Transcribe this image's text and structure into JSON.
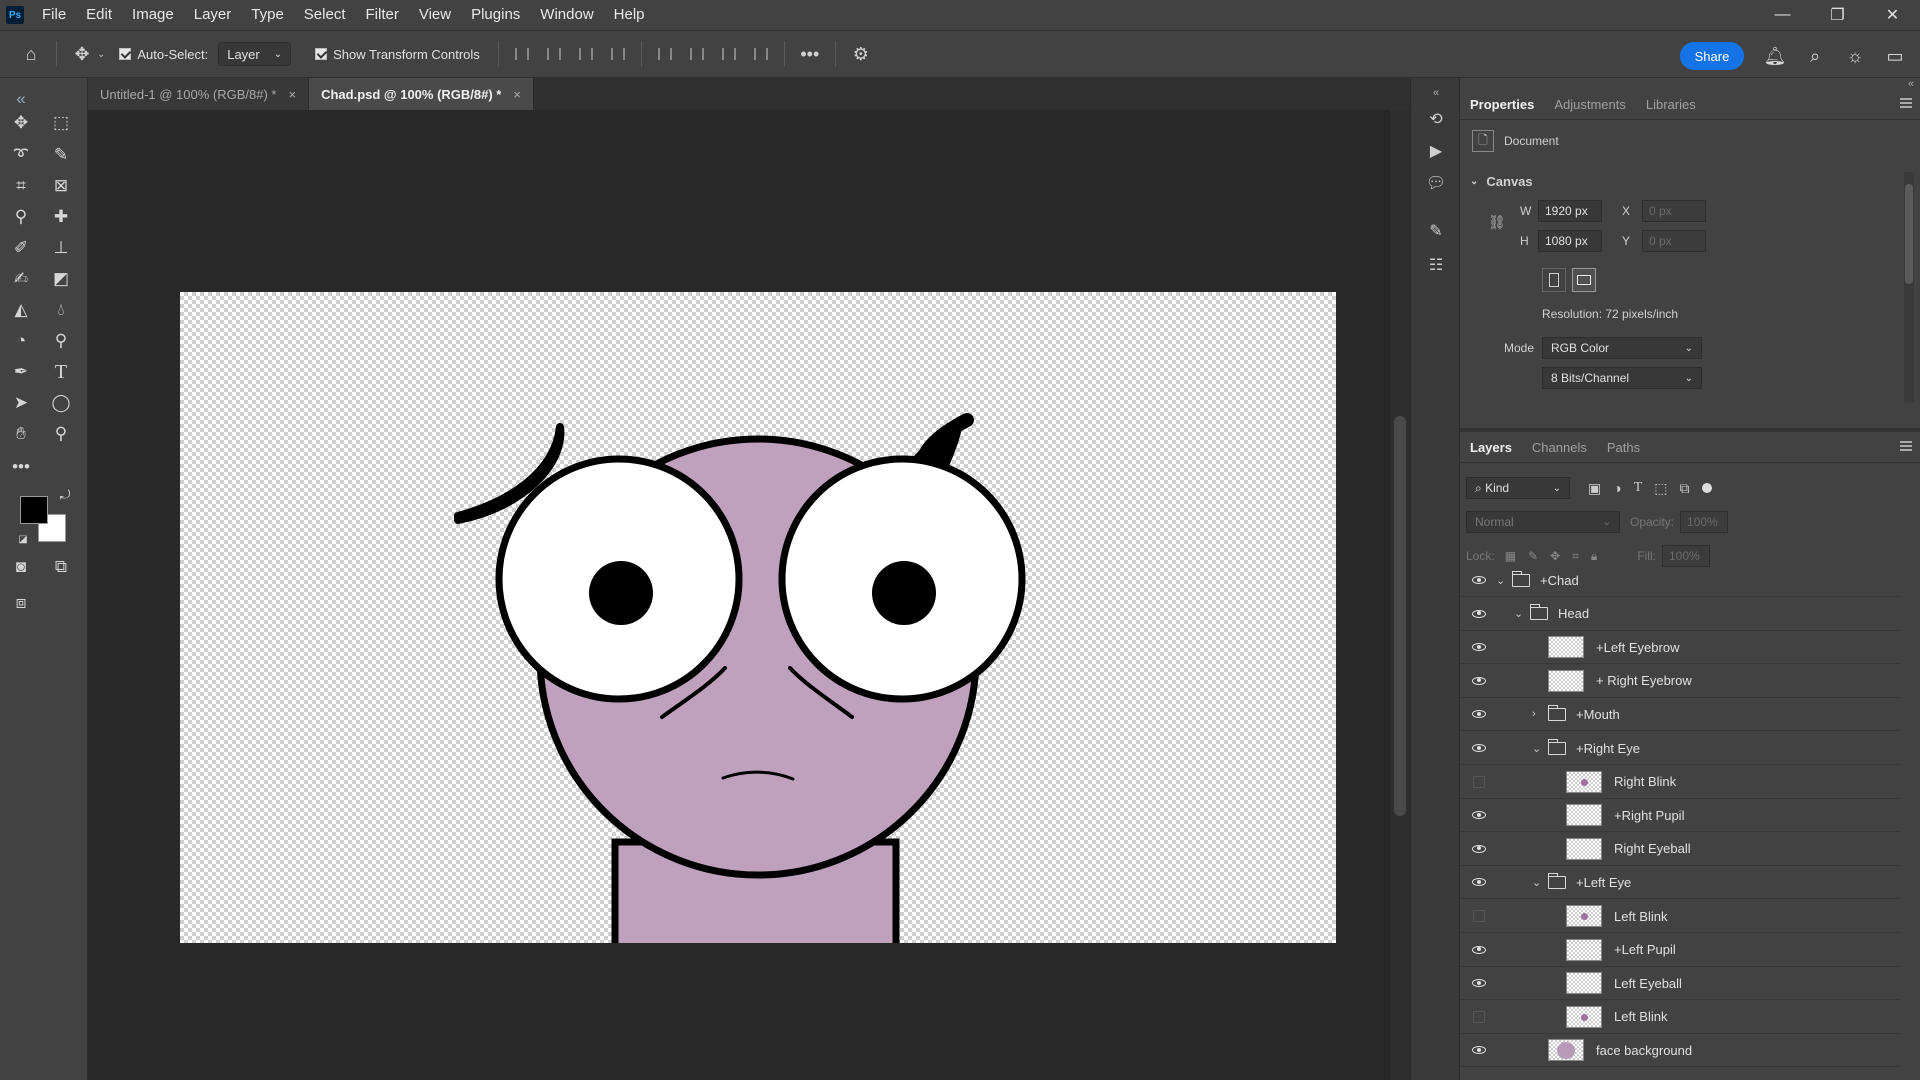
{
  "app": {
    "logo": "Ps"
  },
  "menu": [
    "File",
    "Edit",
    "Image",
    "Layer",
    "Type",
    "Select",
    "Filter",
    "View",
    "Plugins",
    "Window",
    "Help"
  ],
  "window_controls": {
    "minimize": "—",
    "restore": "❐",
    "close": "✕"
  },
  "options": {
    "auto_select_label": "Auto-Select:",
    "auto_select_checked": true,
    "auto_select_target": "Layer",
    "show_transform_label": "Show Transform Controls",
    "show_transform_checked": true,
    "more": "•••",
    "share_label": "Share"
  },
  "tabs": [
    {
      "label": "Untitled-1 @ 100% (RGB/8#) *",
      "active": false
    },
    {
      "label": "Chad.psd @ 100% (RGB/8#) *",
      "active": true
    }
  ],
  "tab_close": "×",
  "properties_panel": {
    "tabs": [
      "Properties",
      "Adjustments",
      "Libraries"
    ],
    "active_tab": "Properties",
    "document_label": "Document",
    "canvas_section": "Canvas",
    "w_label": "W",
    "w_value": "1920 px",
    "h_label": "H",
    "h_value": "1080 px",
    "x_label": "X",
    "x_placeholder": "0 px",
    "y_label": "Y",
    "y_placeholder": "0 px",
    "resolution": "Resolution: 72 pixels/inch",
    "mode_label": "Mode",
    "mode_value": "RGB Color",
    "depth_value": "8 Bits/Channel"
  },
  "layers_panel": {
    "tabs": [
      "Layers",
      "Channels",
      "Paths"
    ],
    "active_tab": "Layers",
    "filter_kind": "Kind",
    "blend_mode": "Normal",
    "opacity_label": "Opacity:",
    "opacity_value": "100%",
    "lock_label": "Lock:",
    "fill_label": "Fill:",
    "fill_value": "100%",
    "layers": [
      {
        "name": "+Chad",
        "type": "group",
        "depth": 0,
        "expanded": true,
        "visible": true
      },
      {
        "name": "Head",
        "type": "group",
        "depth": 1,
        "expanded": true,
        "visible": true
      },
      {
        "name": "+Left Eyebrow",
        "type": "layer",
        "depth": 2,
        "visible": true
      },
      {
        "name": "+ Right Eyebrow",
        "type": "layer",
        "depth": 2,
        "visible": true
      },
      {
        "name": "+Mouth",
        "type": "group",
        "depth": 2,
        "expanded": false,
        "visible": true
      },
      {
        "name": "+Right Eye",
        "type": "group",
        "depth": 2,
        "expanded": true,
        "visible": true
      },
      {
        "name": "Right Blink",
        "type": "layer",
        "depth": 3,
        "visible": false
      },
      {
        "name": "+Right Pupil",
        "type": "layer",
        "depth": 3,
        "visible": true
      },
      {
        "name": "Right Eyeball",
        "type": "layer",
        "depth": 3,
        "visible": true
      },
      {
        "name": "+Left Eye",
        "type": "group",
        "depth": 2,
        "expanded": true,
        "visible": true
      },
      {
        "name": "Left Blink",
        "type": "layer",
        "depth": 3,
        "visible": false
      },
      {
        "name": "+Left Pupil",
        "type": "layer",
        "depth": 3,
        "visible": true
      },
      {
        "name": "Left Eyeball",
        "type": "layer",
        "depth": 3,
        "visible": true
      },
      {
        "name": "Left Blink",
        "type": "layer",
        "depth": 3,
        "visible": false
      },
      {
        "name": "face background",
        "type": "layer",
        "depth": 2,
        "visible": true
      }
    ]
  },
  "colors": {
    "accent": "#1473e6",
    "face": "#bfa0bd",
    "foreground_swatch": "#000000",
    "background_swatch": "#ffffff"
  }
}
